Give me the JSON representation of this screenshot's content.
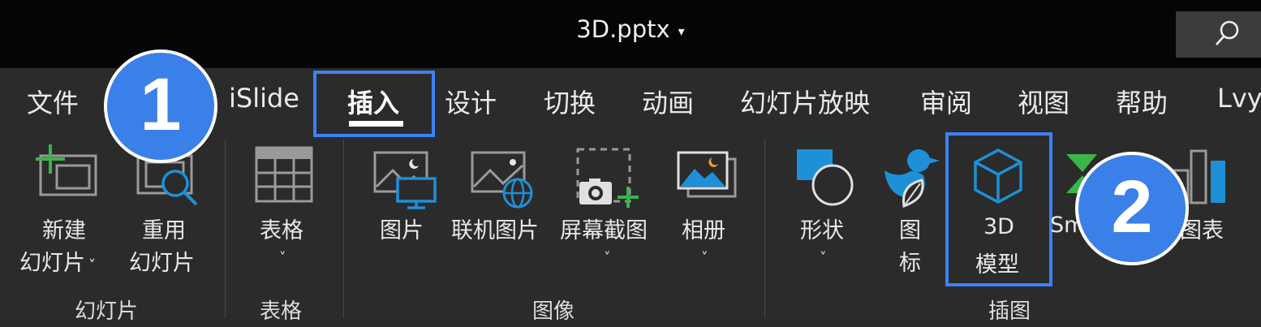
{
  "title_bar": {
    "document_name": "3D.pptx",
    "caret": "▾"
  },
  "tabs": {
    "file": "文件",
    "islide": "iSlide",
    "insert": "插入",
    "design": "设计",
    "transitions": "切换",
    "animations": "动画",
    "slideshow": "幻灯片放映",
    "review": "审阅",
    "view": "视图",
    "help": "帮助",
    "user": "Lvy"
  },
  "ribbon": {
    "new_slide": {
      "line1": "新建",
      "line2": "幻灯片",
      "chevron": "˅"
    },
    "reuse_slides": {
      "line1": "重用",
      "line2": "幻灯片"
    },
    "table": {
      "label": "表格",
      "chevron": "˅"
    },
    "pictures": {
      "label": "图片"
    },
    "online_pictures": {
      "label": "联机图片"
    },
    "screenshot": {
      "label": "屏幕截图",
      "chevron": "˅"
    },
    "photo_album": {
      "label": "相册",
      "chevron": "˅"
    },
    "shapes": {
      "label": "形状",
      "chevron": "˅"
    },
    "icons": {
      "line1": "图",
      "line2": "标"
    },
    "models_3d": {
      "line1": "3D",
      "line2": "模型"
    },
    "smartart": {
      "label": "Sm"
    },
    "chart": {
      "label": "图表"
    }
  },
  "groups": {
    "slides": "幻灯片",
    "tables": "表格",
    "images": "图像",
    "illustrations": "插图"
  },
  "annotations": {
    "step1": "1",
    "step2": "2"
  },
  "colors": {
    "accent_blue": "#3b82f6",
    "badge_blue": "#3b7fe8",
    "green": "#3bb54a",
    "icon_blue": "#1e90d8"
  }
}
